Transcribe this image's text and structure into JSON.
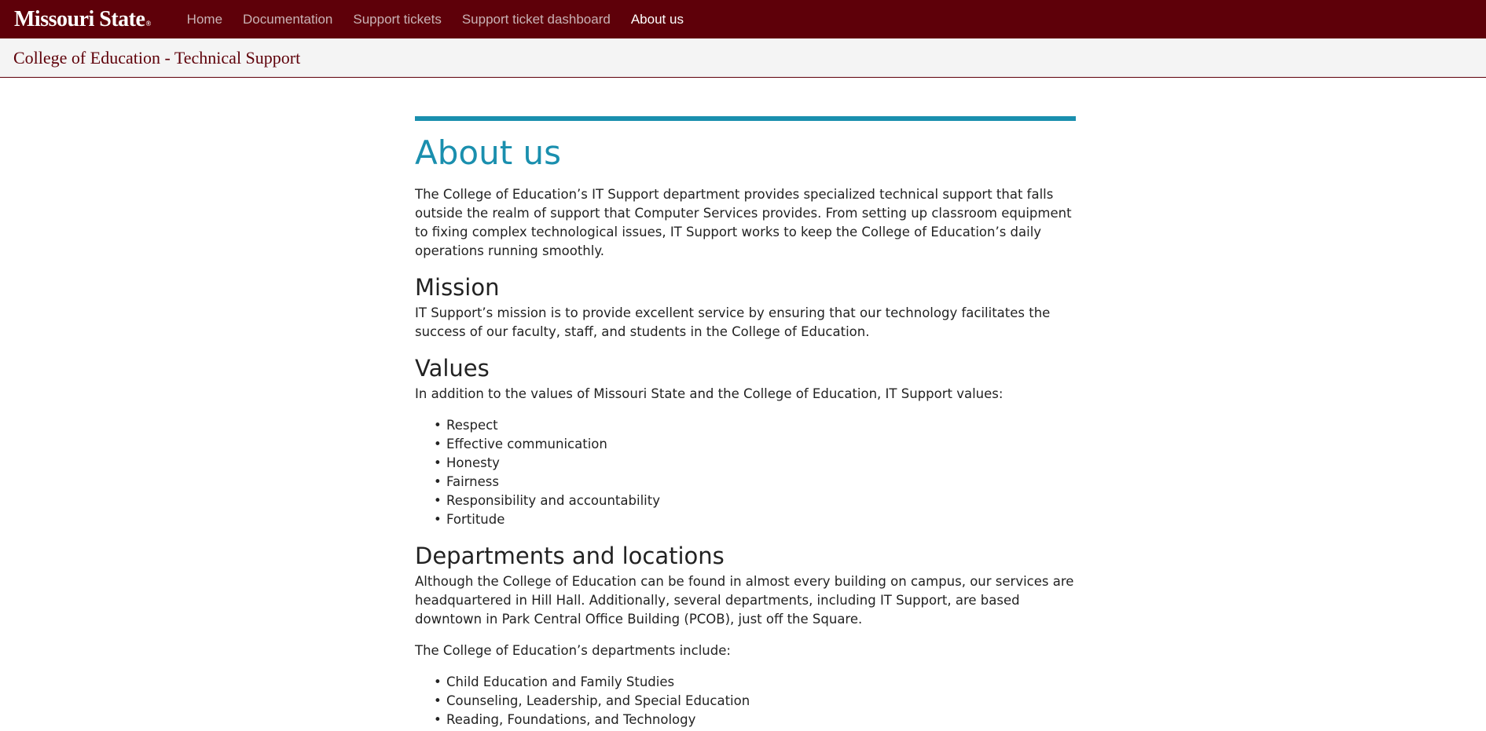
{
  "nav": {
    "brand": "Missouri State",
    "brand_mark": "®",
    "links": [
      {
        "label": "Home",
        "active": false
      },
      {
        "label": "Documentation",
        "active": false
      },
      {
        "label": "Support tickets",
        "active": false
      },
      {
        "label": "Support ticket dashboard",
        "active": false
      },
      {
        "label": "About us",
        "active": true
      }
    ]
  },
  "site_title": "College of Education - Technical Support",
  "page": {
    "title": "About us",
    "intro": "The College of Education’s IT Support department provides specialized technical support that falls outside the realm of support that Computer Services provides. From setting up classroom equipment to fixing complex technological issues, IT Support works to keep the College of Education’s daily operations running smoothly.",
    "mission_heading": "Mission",
    "mission_text": "IT Support’s mission is to provide excellent service by ensuring that our technology facilitates the success of our faculty, staff, and students in the College of Education.",
    "values_heading": "Values",
    "values_intro": "In addition to the values of Missouri State and the College of Education, IT Support values:",
    "values": [
      "Respect",
      "Effective communication",
      "Honesty",
      "Fairness",
      "Responsibility and accountability",
      "Fortitude"
    ],
    "departments_heading": "Departments and locations",
    "departments_text": "Although the College of Education can be found in almost every building on campus, our services are headquartered in Hill Hall. Additionally, several departments, including IT Support, are based downtown in Park Central Office Building (PCOB), just off the Square.",
    "departments_intro": "The College of Education’s departments include:",
    "departments": [
      "Child Education and Family Studies",
      "Counseling, Leadership, and Special Education",
      "Reading, Foundations, and Technology"
    ]
  },
  "colors": {
    "nav_bg": "#5e0009",
    "accent": "#1a8fae"
  }
}
